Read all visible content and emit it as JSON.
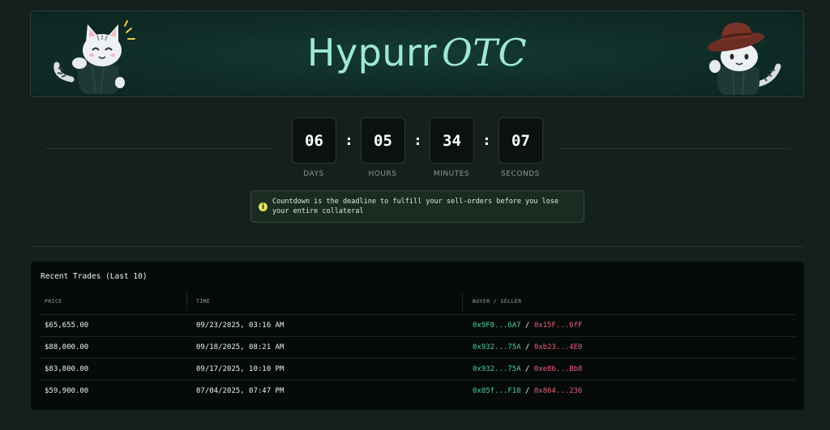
{
  "header": {
    "brand_part1": "Hypurr",
    "brand_part2": "OTC"
  },
  "countdown": {
    "days": "06",
    "hours": "05",
    "minutes": "34",
    "seconds": "07",
    "separator": ":",
    "labels": {
      "days": "DAYS",
      "hours": "HOURS",
      "minutes": "MINUTES",
      "seconds": "SECONDS"
    },
    "notice": "Countdown is the deadline to fulfill your sell-orders before you lose your entire collateral",
    "notice_icon": "i"
  },
  "trades": {
    "title": "Recent Trades (Last 10)",
    "columns": {
      "price": "PRICE",
      "time": "TIME",
      "parties": "BUYER / SELLER"
    },
    "rows": [
      {
        "price": "$65,655.00",
        "time": "09/23/2025, 03:16 AM",
        "buyer": "0x9F0...6A7",
        "seller": "0x15F...6fF"
      },
      {
        "price": "$88,000.00",
        "time": "09/18/2025, 08:21 AM",
        "buyer": "0x932...75A",
        "seller": "0xb23...4E0"
      },
      {
        "price": "$83,800.00",
        "time": "09/17/2025, 10:10 PM",
        "buyer": "0x932...75A",
        "seller": "0xe86...Bb8"
      },
      {
        "price": "$59,900.00",
        "time": "07/04/2025, 07:47 PM",
        "buyer": "0x05f...F10",
        "seller": "0x864...236"
      }
    ],
    "party_separator": "/"
  },
  "colors": {
    "background": "#151f1e",
    "brand": "#9fe8d3",
    "buyer": "#4fd1a0",
    "seller": "#e8627a"
  },
  "icons": {
    "left_mascot": "cat-mascot-icon",
    "right_mascot": "cowboy-cat-mascot-icon",
    "notice": "info-icon"
  }
}
